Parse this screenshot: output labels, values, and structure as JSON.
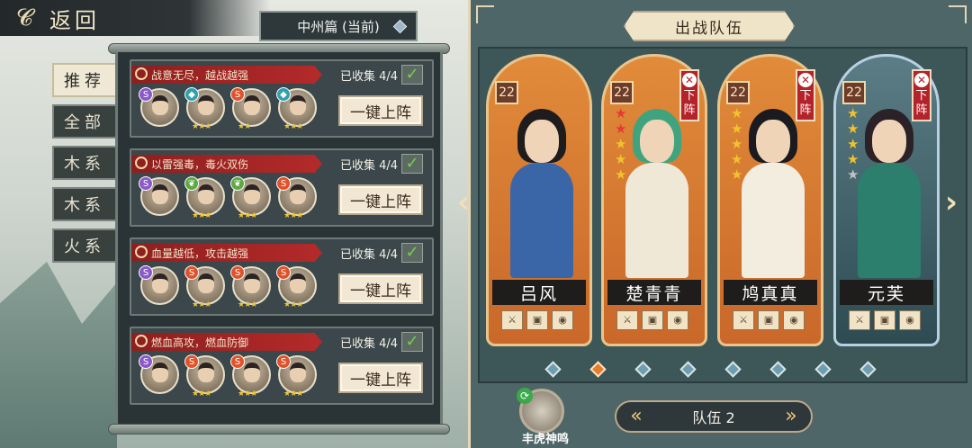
{
  "header": {
    "back_label": "返回"
  },
  "chapter": {
    "label": "中州篇 (当前)"
  },
  "tabs": [
    "推荐",
    "全部",
    "木系",
    "木系",
    "火系"
  ],
  "lineups": [
    {
      "title": "战意无尽，越战越强",
      "collected": "已收集 4/4",
      "button": "一键上阵",
      "heroes": [
        {
          "el": "S",
          "color": "#8b59c9",
          "stars": ""
        },
        {
          "el": "◆",
          "color": "#2f9fb1",
          "stars": "★★★"
        },
        {
          "el": "S",
          "color": "#e0532a",
          "stars": "★★"
        },
        {
          "el": "◆",
          "color": "#2f9fb1",
          "stars": "★★★"
        }
      ]
    },
    {
      "title": "以雷强毒，毒火双伤",
      "collected": "已收集 4/4",
      "button": "一键上阵",
      "heroes": [
        {
          "el": "S",
          "color": "#8b59c9",
          "stars": ""
        },
        {
          "el": "❦",
          "color": "#5ea844",
          "stars": "★★★"
        },
        {
          "el": "❦",
          "color": "#5ea844",
          "stars": "★★★"
        },
        {
          "el": "S",
          "color": "#e0532a",
          "stars": "★★★"
        }
      ]
    },
    {
      "title": "血量越低，攻击越强",
      "collected": "已收集 4/4",
      "button": "一键上阵",
      "heroes": [
        {
          "el": "S",
          "color": "#8b59c9",
          "stars": ""
        },
        {
          "el": "S",
          "color": "#e0532a",
          "stars": "★★★"
        },
        {
          "el": "S",
          "color": "#e0532a",
          "stars": "★★★"
        },
        {
          "el": "S",
          "color": "#e0532a",
          "stars": "★★★"
        }
      ]
    },
    {
      "title": "燃血高攻，燃血防御",
      "collected": "已收集 4/4",
      "button": "一键上阵",
      "heroes": [
        {
          "el": "S",
          "color": "#8b59c9",
          "stars": ""
        },
        {
          "el": "S",
          "color": "#e0532a",
          "stars": "★★★"
        },
        {
          "el": "S",
          "color": "#e0532a",
          "stars": "★★★"
        },
        {
          "el": "S",
          "color": "#e0532a",
          "stars": "★★★"
        }
      ]
    }
  ],
  "team": {
    "title": "出战队伍",
    "remove_label": "下阵",
    "members": [
      {
        "name": "吕风",
        "level": "22",
        "stars": [],
        "removable": false,
        "theme": "orange",
        "hair": "#1f1c1e",
        "body": "#3a66a8"
      },
      {
        "name": "楚青青",
        "level": "22",
        "stars": [
          "red",
          "red",
          "gold",
          "gold",
          "gold"
        ],
        "removable": true,
        "theme": "orange",
        "hair": "#3fa37d",
        "body": "#efe8d6"
      },
      {
        "name": "鸠真真",
        "level": "22",
        "stars": [
          "gold",
          "gold",
          "gold",
          "gold",
          "gold"
        ],
        "removable": true,
        "theme": "orange",
        "hair": "#1a1a1f",
        "body": "#f3ede0"
      },
      {
        "name": "元芙",
        "level": "22",
        "stars": [
          "gold",
          "gold",
          "gold",
          "gold",
          "grey"
        ],
        "removable": true,
        "theme": "blue",
        "hair": "#2a2226",
        "body": "#2c7f6c"
      }
    ],
    "selector": "队伍 2",
    "page_dots": 8,
    "active_dot": 1,
    "skill_label": "丰虎神鸣"
  }
}
